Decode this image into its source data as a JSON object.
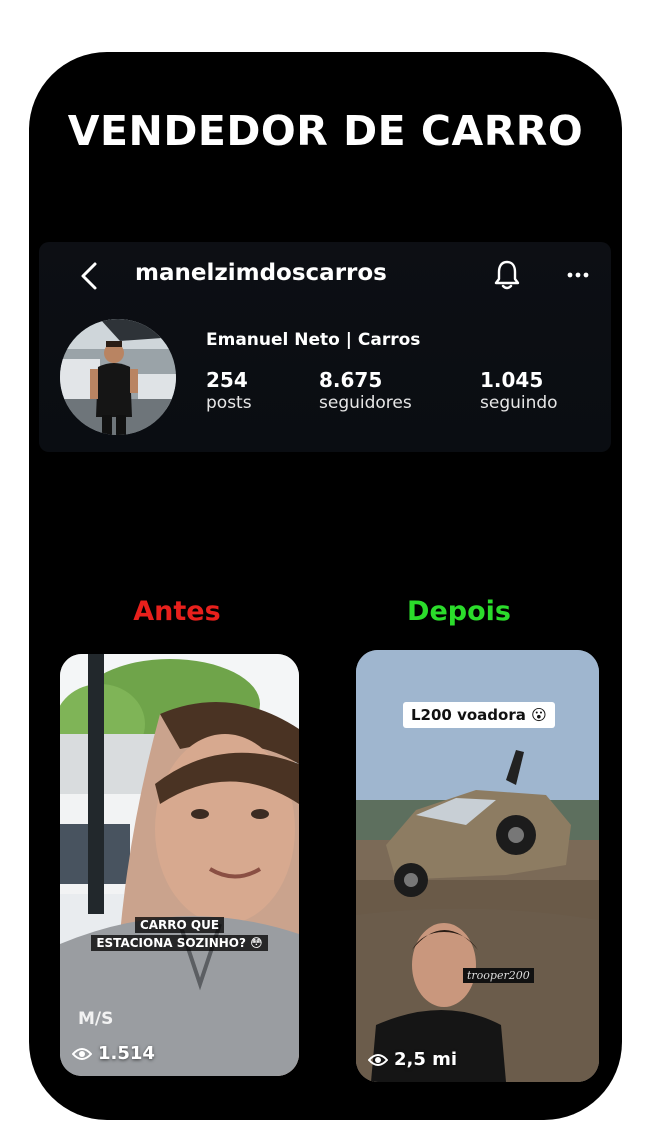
{
  "headline": "VENDEDOR DE CARRO",
  "profile": {
    "username": "manelzimdoscarros",
    "display_name": "Emanuel Neto | Carros",
    "stats": [
      {
        "value": "254",
        "label": "posts"
      },
      {
        "value": "8.675",
        "label": "seguidores"
      },
      {
        "value": "1.045",
        "label": "seguindo"
      }
    ]
  },
  "compare": {
    "before_label": "Antes",
    "after_label": "Depois",
    "before_color": "#e8201c",
    "after_color": "#2bdc2b"
  },
  "reels": {
    "before": {
      "caption_line1": "CARRO QUE",
      "caption_line2": "ESTACIONA SOZINHO? 😳",
      "shirt_logo": "M/S",
      "views": "1.514"
    },
    "after": {
      "sticker": "L200 voadora 😮",
      "handle_tag": "trooper200",
      "views": "2,5 mi"
    }
  },
  "icons": [
    "back-icon",
    "bell-icon",
    "more-icon",
    "eye-icon"
  ]
}
